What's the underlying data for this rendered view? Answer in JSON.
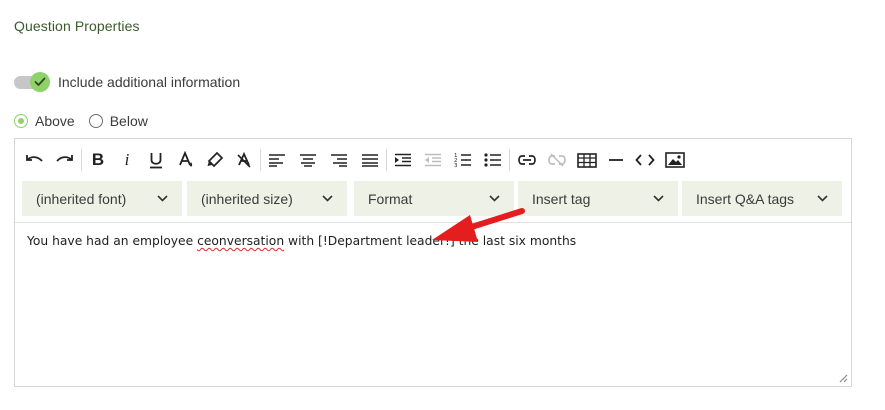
{
  "section": {
    "title": "Question Properties"
  },
  "include_info": {
    "label": "Include additional information",
    "enabled": true
  },
  "position": {
    "options": [
      "Above",
      "Below"
    ],
    "selected": "Above"
  },
  "toolbar": {
    "buttons": [
      "undo-icon",
      "redo-icon",
      "bold-icon",
      "italic-icon",
      "underline-icon",
      "text-color-icon",
      "highlight-icon",
      "clear-format-icon",
      "align-left-icon",
      "align-center-icon",
      "align-right-icon",
      "justify-icon",
      "indent-icon",
      "outdent-icon",
      "numbered-list-icon",
      "bulleted-list-icon",
      "link-icon",
      "unlink-icon",
      "table-icon",
      "horizontal-rule-icon",
      "source-code-icon",
      "image-icon"
    ],
    "bold": "B",
    "italic": "i"
  },
  "dropdowns": {
    "font": "(inherited font)",
    "size": "(inherited size)",
    "format": "Format",
    "insert_tag": "Insert tag",
    "insert_qa_tags": "Insert Q&A tags"
  },
  "editor": {
    "text_before": "You have had an employee ",
    "misspelled_word": "ceonversation",
    "text_after": " with [!Department leader!] the last six months"
  },
  "colors": {
    "accent_green": "#8fd16a",
    "title_green": "#3a5a2e",
    "dropdown_bg": "#eef1e5",
    "annotation_red": "#e41e1e"
  }
}
